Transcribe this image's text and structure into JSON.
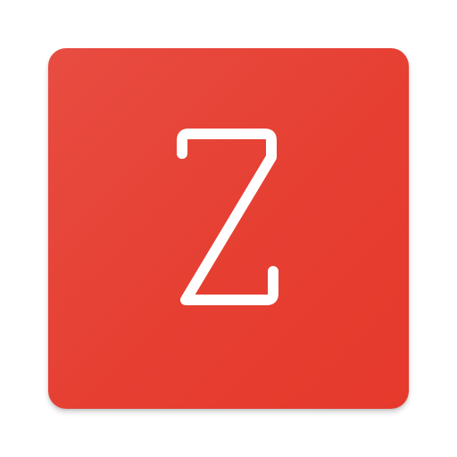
{
  "app_icon": {
    "letter": "Z",
    "background_color": "#e6402f",
    "glyph_color": "#ffffff"
  }
}
